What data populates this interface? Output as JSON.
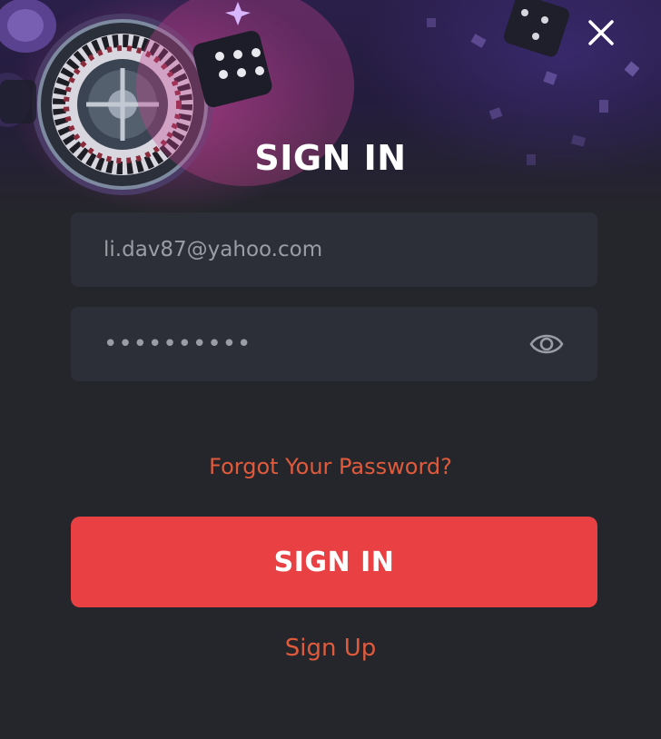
{
  "modal": {
    "title": "SIGN IN",
    "email_value": "li.dav87@yahoo.com",
    "password_value": "••••••••••",
    "forgot_label": "Forgot Your Password?",
    "submit_label": "SIGN IN",
    "signup_label": "Sign Up"
  },
  "icons": {
    "close": "close-icon",
    "eye": "eye-icon"
  },
  "colors": {
    "background": "#25262b",
    "field": "#2d2f38",
    "accent": "#e84043",
    "link": "#e05a3c"
  }
}
